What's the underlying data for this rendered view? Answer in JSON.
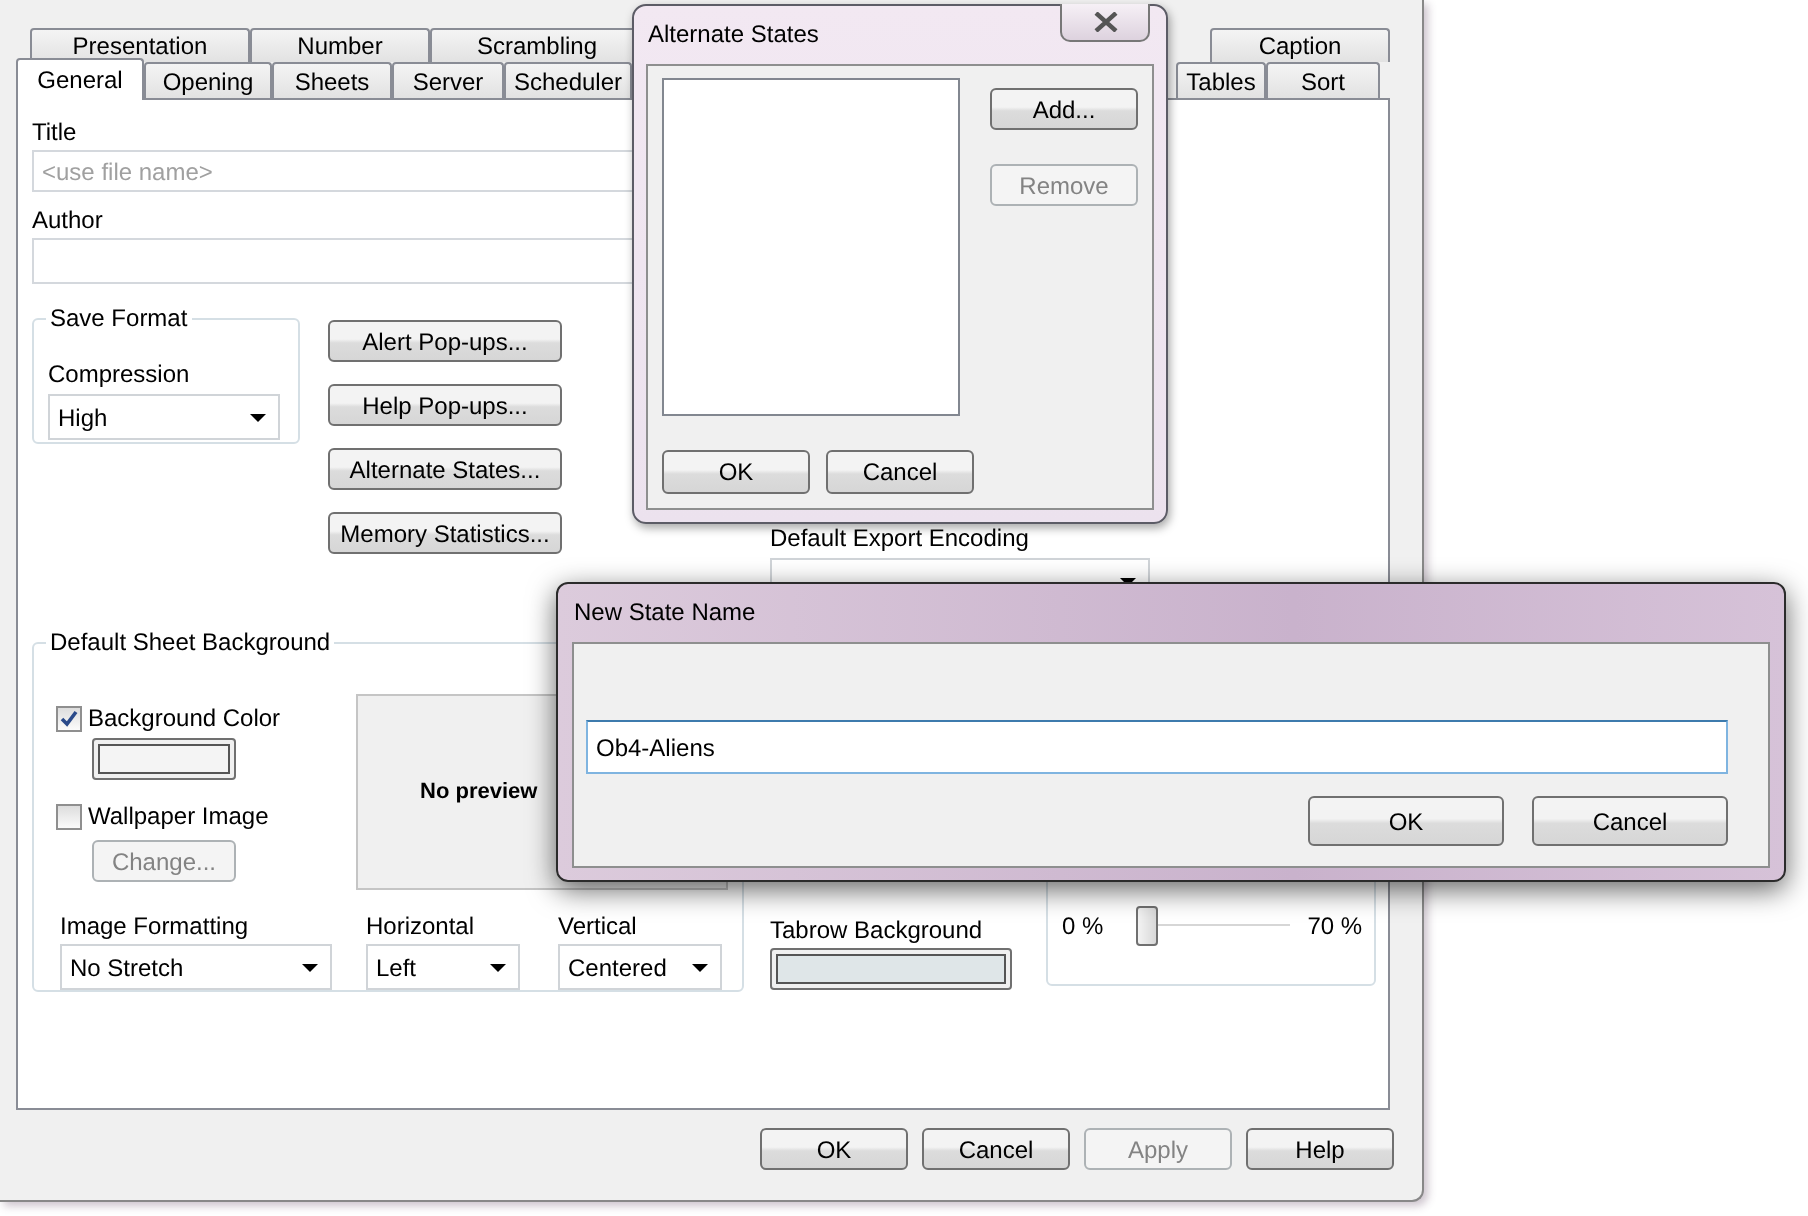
{
  "main_window": {
    "tab_rows": [
      {
        "left": [
          {
            "label": "Presentation",
            "selected": false
          },
          {
            "label": "Number",
            "selected": false
          },
          {
            "label": "Scrambling",
            "selected": false
          }
        ],
        "right": [
          {
            "label": "Caption",
            "selected": false
          }
        ]
      },
      {
        "left": [
          {
            "label": "General",
            "selected": true
          },
          {
            "label": "Opening",
            "selected": false
          },
          {
            "label": "Sheets",
            "selected": false
          },
          {
            "label": "Server",
            "selected": false
          },
          {
            "label": "Scheduler",
            "selected": false
          }
        ],
        "right": [
          {
            "label": "Tables",
            "selected": false
          },
          {
            "label": "Sort",
            "selected": false
          }
        ]
      }
    ],
    "title_field": {
      "label": "Title",
      "placeholder": "<use file name>"
    },
    "author_field": {
      "label": "Author"
    },
    "save_format": {
      "legend": "Save Format",
      "compression_label": "Compression",
      "compression_value": "High"
    },
    "side_buttons": [
      "Alert Pop-ups...",
      "Help Pop-ups...",
      "Alternate States...",
      "Memory Statistics..."
    ],
    "sheet_background": {
      "legend": "Default Sheet Background",
      "options": [
        {
          "label": "Background Color",
          "checked": true,
          "kind": "color"
        },
        {
          "label": "Wallpaper Image",
          "checked": false,
          "kind": "image",
          "button": {
            "label": "Change...",
            "disabled": true
          }
        }
      ],
      "preview_text": "No preview",
      "selects": [
        {
          "label": "Image Formatting",
          "value": "No Stretch"
        },
        {
          "label": "Horizontal",
          "value": "Left"
        },
        {
          "label": "Vertical",
          "value": "Centered"
        }
      ]
    },
    "export_encoding": {
      "label": "Default Export Encoding"
    },
    "tabrow_background": {
      "label": "Tabrow Background"
    },
    "transparency": {
      "min_label": "0 %",
      "max_label": "70 %",
      "level": 0
    },
    "buttons": [
      {
        "label": "OK",
        "disabled": false
      },
      {
        "label": "Cancel",
        "disabled": false
      },
      {
        "label": "Apply",
        "disabled": true
      },
      {
        "label": "Help",
        "disabled": false
      }
    ]
  },
  "alternate_states_dialog": {
    "title": "Alternate States",
    "side_buttons": [
      {
        "label": "Add...",
        "disabled": false
      },
      {
        "label": "Remove",
        "disabled": true
      }
    ],
    "buttons": [
      "OK",
      "Cancel"
    ]
  },
  "new_state_dialog": {
    "title": "New State Name",
    "value": "Ob4-Aliens",
    "buttons": [
      "OK",
      "Cancel"
    ]
  }
}
